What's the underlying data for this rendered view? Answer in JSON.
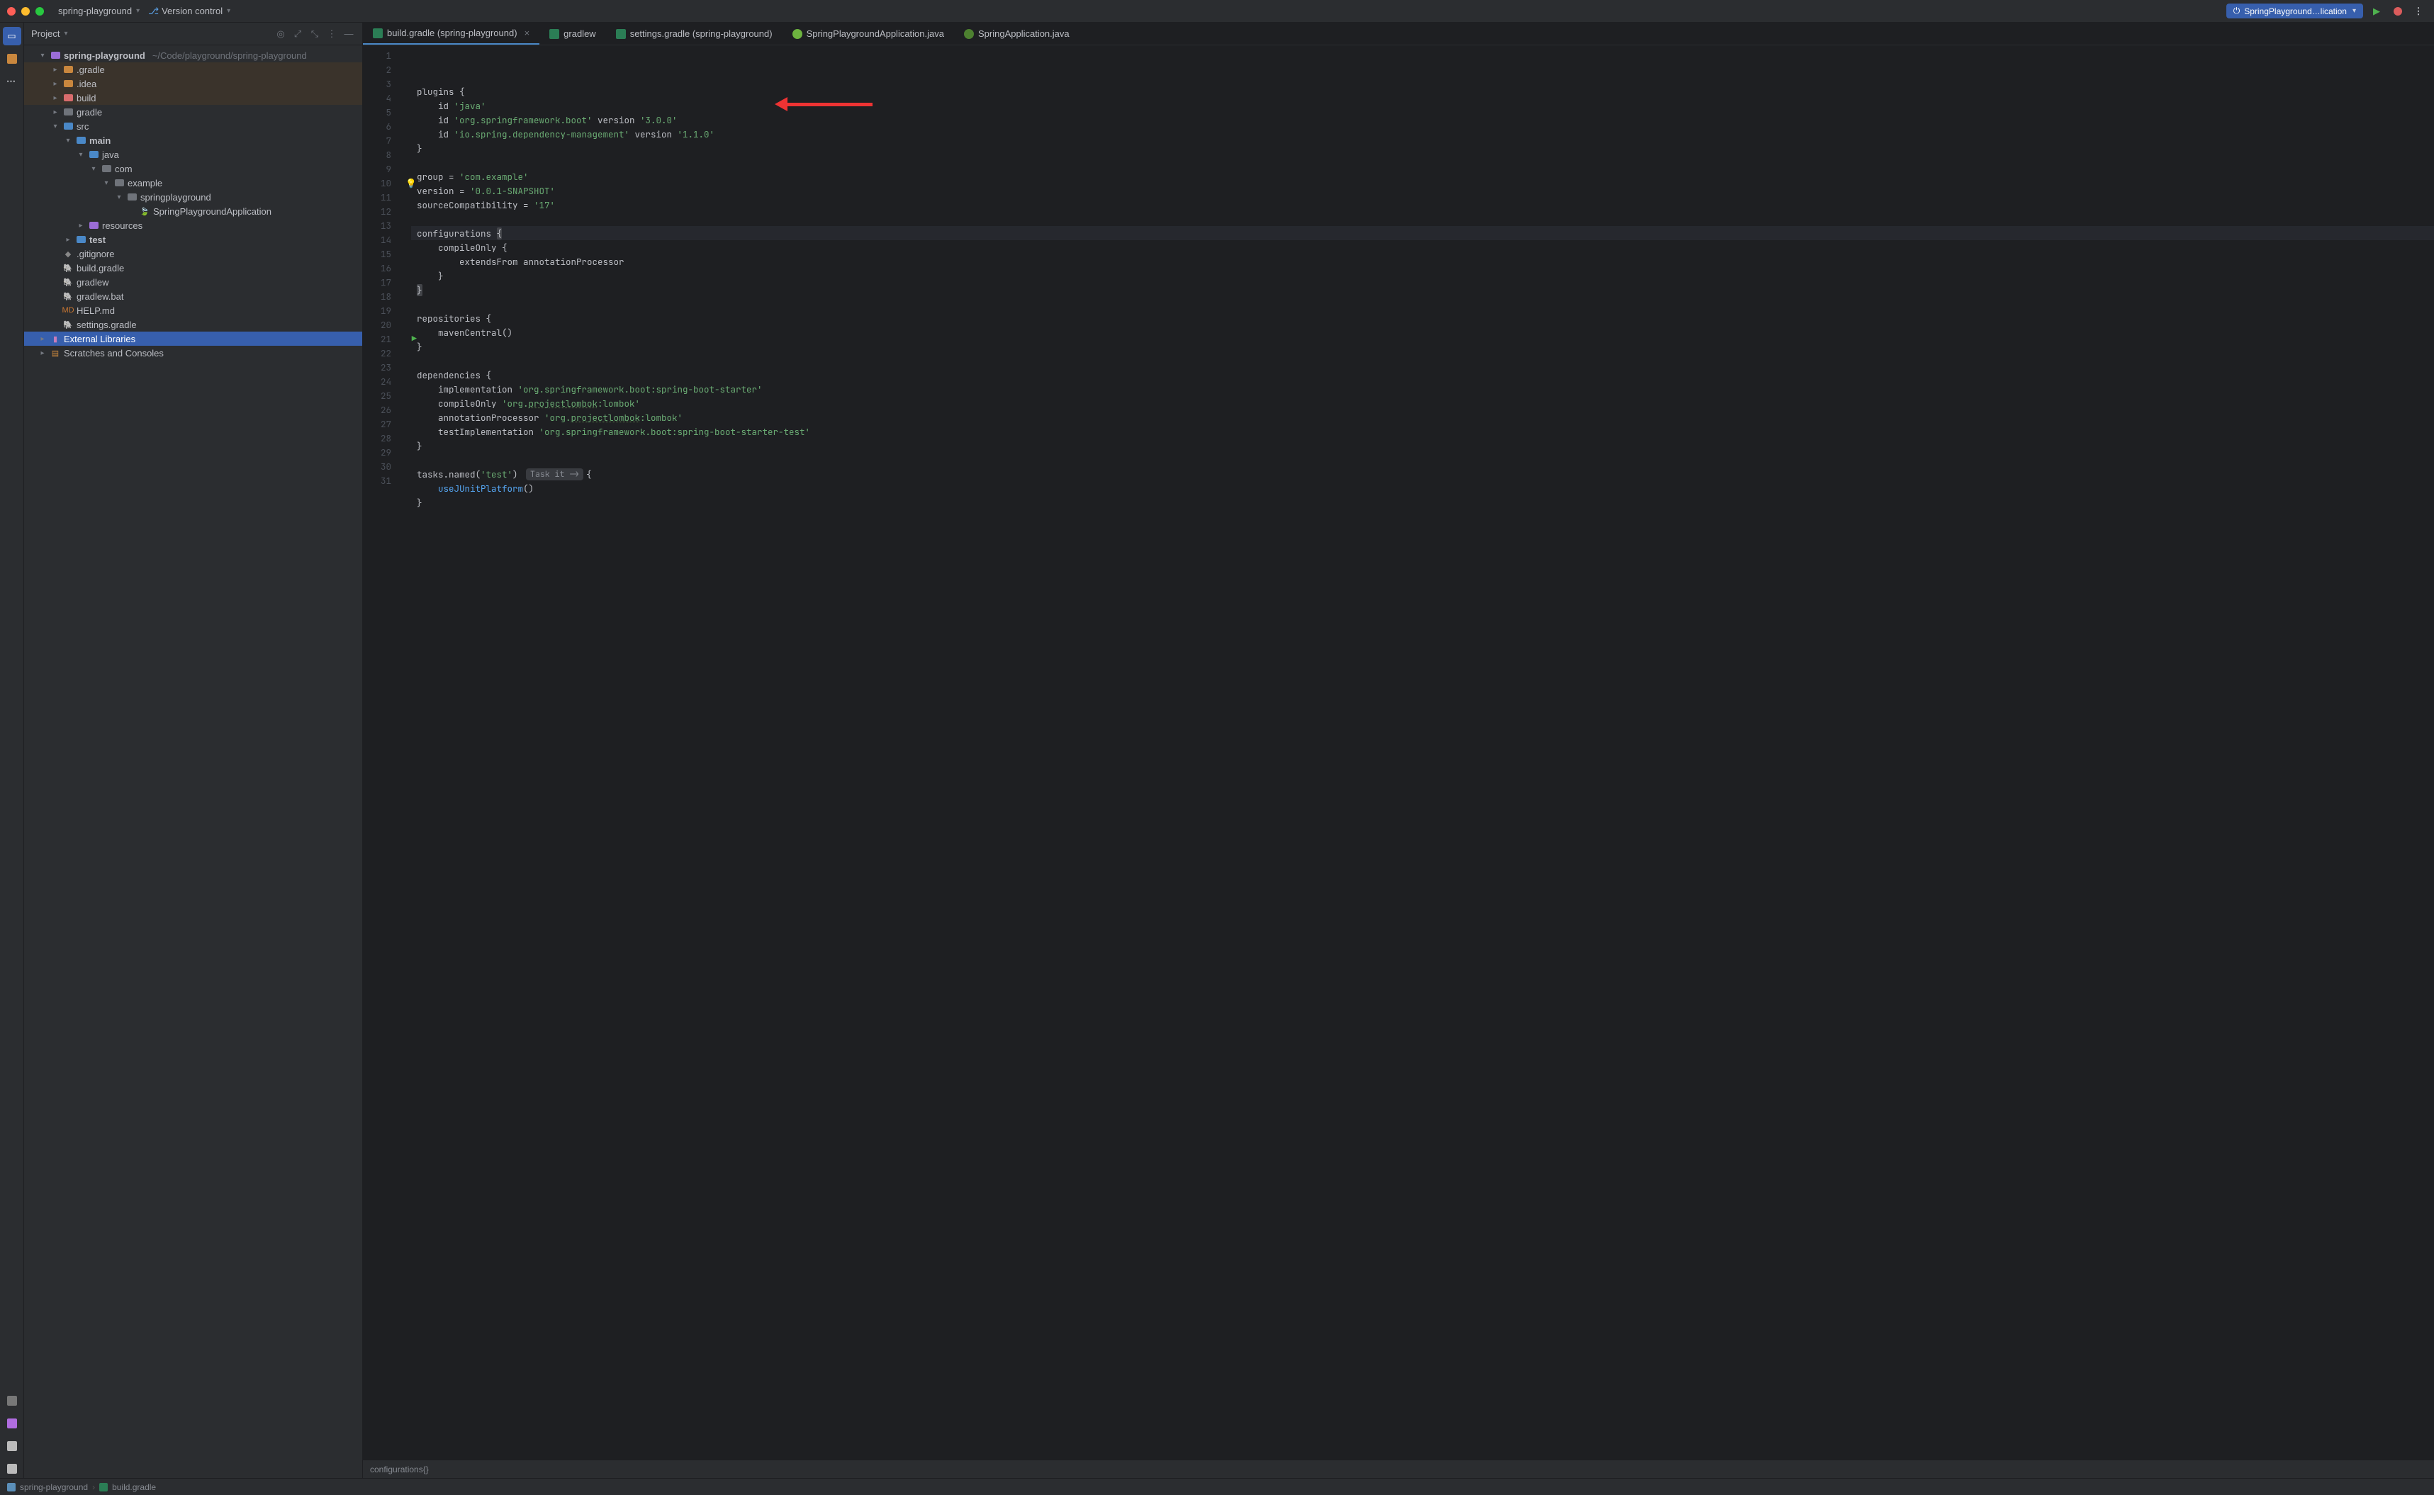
{
  "titlebar": {
    "project_name": "spring-playground",
    "vcs_label": "Version control",
    "run_config": "SpringPlayground…lication"
  },
  "project_panel": {
    "title": "Project",
    "root_name": "spring-playground",
    "root_path": "~/Code/playground/spring-playground",
    "nodes": {
      "gradle_dot": ".gradle",
      "idea": ".idea",
      "build": "build",
      "gradle": "gradle",
      "src": "src",
      "main": "main",
      "java": "java",
      "com": "com",
      "example": "example",
      "springplayground": "springplayground",
      "app_class": "SpringPlaygroundApplication",
      "resources": "resources",
      "test": "test",
      "gitignore": ".gitignore",
      "build_gradle": "build.gradle",
      "gradlew": "gradlew",
      "gradlew_bat": "gradlew.bat",
      "help_md": "HELP.md",
      "settings_gradle": "settings.gradle",
      "ext_libs": "External Libraries",
      "scratches": "Scratches and Consoles"
    }
  },
  "tabs": [
    {
      "label": "build.gradle (spring-playground)",
      "icon": "gradle",
      "active": true,
      "closeable": true
    },
    {
      "label": "gradlew",
      "icon": "gradle"
    },
    {
      "label": "settings.gradle (spring-playground)",
      "icon": "gradle"
    },
    {
      "label": "SpringPlaygroundApplication.java",
      "icon": "spring"
    },
    {
      "label": "SpringApplication.java",
      "icon": "dim-spring"
    }
  ],
  "code": {
    "lines": [
      {
        "n": 1,
        "seg": [
          [
            "id",
            "plugins "
          ],
          [
            "fn",
            "{"
          ]
        ]
      },
      {
        "n": 2,
        "seg": [
          [
            "id",
            "    id "
          ],
          [
            "str",
            "'java'"
          ]
        ]
      },
      {
        "n": 3,
        "seg": [
          [
            "id",
            "    id "
          ],
          [
            "str",
            "'org.springframework.boot'"
          ],
          [
            "id",
            " version "
          ],
          [
            "str",
            "'3.0.0'"
          ]
        ]
      },
      {
        "n": 4,
        "seg": [
          [
            "id",
            "    id "
          ],
          [
            "str",
            "'io.spring.dependency-management'"
          ],
          [
            "id",
            " version "
          ],
          [
            "str",
            "'1.1.0'"
          ]
        ]
      },
      {
        "n": 5,
        "seg": [
          [
            "fn",
            "}"
          ]
        ]
      },
      {
        "n": 6,
        "seg": [
          [
            "id",
            ""
          ]
        ]
      },
      {
        "n": 7,
        "seg": [
          [
            "id",
            "group = "
          ],
          [
            "str",
            "'com.example'"
          ]
        ]
      },
      {
        "n": 8,
        "seg": [
          [
            "id",
            "version = "
          ],
          [
            "str",
            "'0.0.1-SNAPSHOT'"
          ]
        ]
      },
      {
        "n": 9,
        "seg": [
          [
            "id",
            "sourceCompatibility = "
          ],
          [
            "str",
            "'17'"
          ]
        ]
      },
      {
        "n": 10,
        "bulb": true,
        "seg": [
          [
            "id",
            ""
          ]
        ]
      },
      {
        "n": 11,
        "hl": true,
        "seg": [
          [
            "id",
            "configurations "
          ],
          [
            "brace",
            "{"
          ]
        ]
      },
      {
        "n": 12,
        "seg": [
          [
            "id",
            "    compileOnly "
          ],
          [
            "fn",
            "{"
          ]
        ]
      },
      {
        "n": 13,
        "seg": [
          [
            "id",
            "        extendsFrom annotationProcessor"
          ]
        ]
      },
      {
        "n": 14,
        "seg": [
          [
            "id",
            "    "
          ],
          [
            "fn",
            "}"
          ]
        ]
      },
      {
        "n": 15,
        "seg": [
          [
            "brace",
            "}"
          ]
        ]
      },
      {
        "n": 16,
        "seg": [
          [
            "id",
            ""
          ]
        ]
      },
      {
        "n": 17,
        "seg": [
          [
            "id",
            "repositories "
          ],
          [
            "fn",
            "{"
          ]
        ]
      },
      {
        "n": 18,
        "seg": [
          [
            "id",
            "    mavenCentral()"
          ]
        ]
      },
      {
        "n": 19,
        "seg": [
          [
            "fn",
            "}"
          ]
        ]
      },
      {
        "n": 20,
        "seg": [
          [
            "id",
            ""
          ]
        ]
      },
      {
        "n": 21,
        "play": true,
        "seg": [
          [
            "id",
            "dependencies "
          ],
          [
            "fn",
            "{"
          ]
        ]
      },
      {
        "n": 22,
        "seg": [
          [
            "id",
            "    implementation "
          ],
          [
            "str",
            "'org.springframework.boot:spring-boot-starter'"
          ]
        ]
      },
      {
        "n": 23,
        "seg": [
          [
            "id",
            "    compileOnly "
          ],
          [
            "str",
            "'org."
          ],
          [
            "und",
            "projectlombok"
          ],
          [
            "str",
            ":lombok'"
          ]
        ]
      },
      {
        "n": 24,
        "seg": [
          [
            "id",
            "    annotationProcessor "
          ],
          [
            "str",
            "'org."
          ],
          [
            "und",
            "projectlombok"
          ],
          [
            "str",
            ":lombok'"
          ]
        ]
      },
      {
        "n": 25,
        "seg": [
          [
            "id",
            "    testImplementation "
          ],
          [
            "str",
            "'org.springframework.boot:spring-boot-starter-test'"
          ]
        ]
      },
      {
        "n": 26,
        "seg": [
          [
            "fn",
            "}"
          ]
        ]
      },
      {
        "n": 27,
        "seg": [
          [
            "id",
            ""
          ]
        ]
      },
      {
        "n": 28,
        "hint": "Task it ->",
        "seg": [
          [
            "id",
            "tasks.named("
          ],
          [
            "str",
            "'test'"
          ],
          [
            "id",
            ") "
          ],
          [
            "fn",
            "{"
          ]
        ]
      },
      {
        "n": 29,
        "seg": [
          [
            "id",
            "    "
          ],
          [
            "idl",
            "useJUnitPlatform"
          ],
          [
            "id",
            "()"
          ]
        ]
      },
      {
        "n": 30,
        "seg": [
          [
            "fn",
            "}"
          ]
        ]
      },
      {
        "n": 31,
        "seg": [
          [
            "id",
            ""
          ]
        ]
      }
    ]
  },
  "status_strip": "configurations{}",
  "breadcrumbs": {
    "project": "spring-playground",
    "file": "build.gradle"
  }
}
